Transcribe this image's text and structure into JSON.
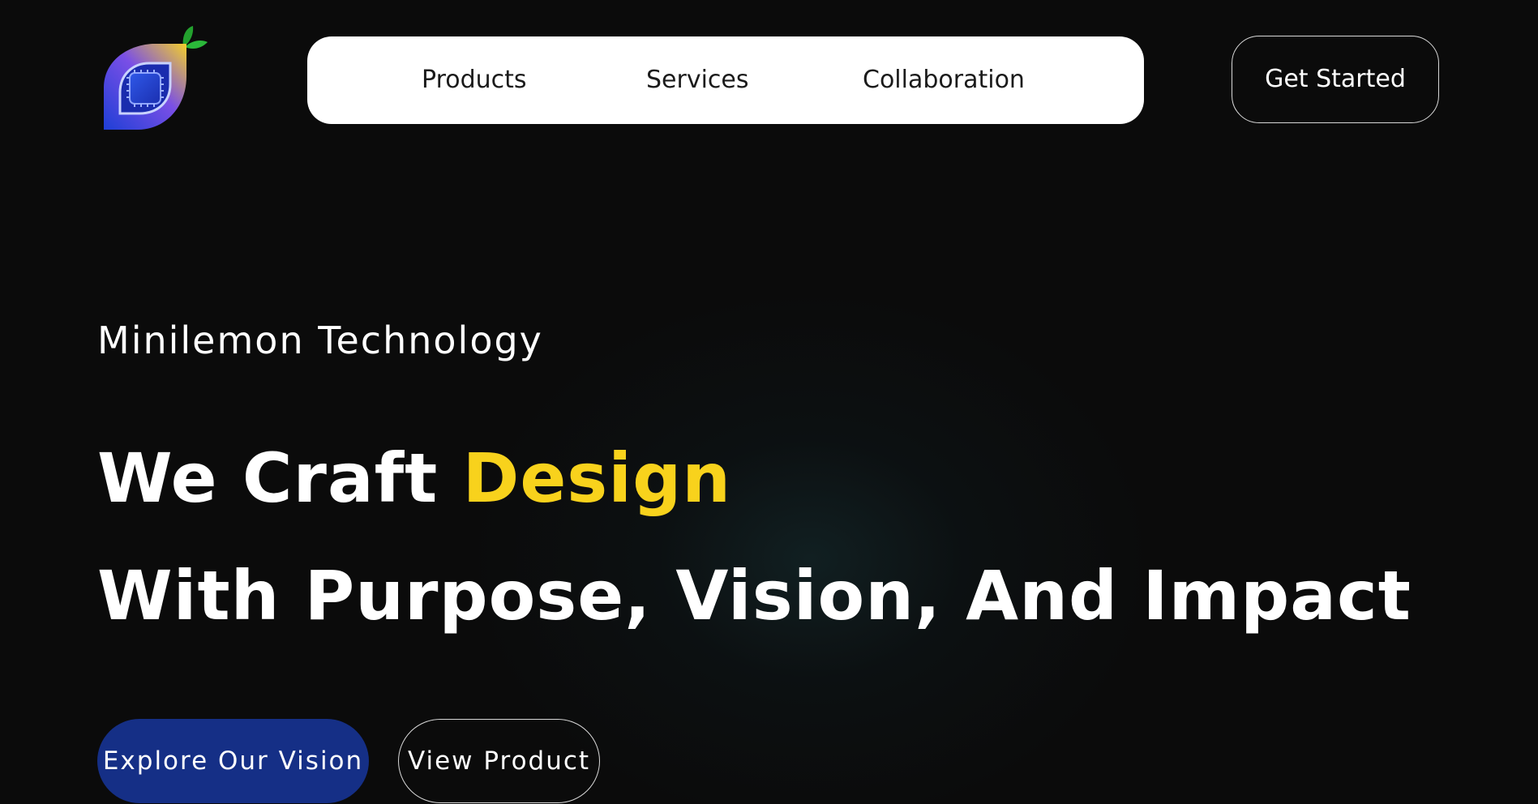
{
  "header": {
    "logo": {
      "icon": "lemon-chip-logo-icon"
    },
    "nav": {
      "items": [
        {
          "label": "Products"
        },
        {
          "label": "Services"
        },
        {
          "label": "Collaboration"
        }
      ]
    },
    "cta_label": "Get Started"
  },
  "hero": {
    "eyebrow": "Minilemon Technology",
    "headline_line1_prefix": "We Craft",
    "headline_line1_accent": "Design",
    "headline_line2": "With Purpose, Vision, And Impact",
    "primary_button_label": "Explore Our Vision",
    "secondary_button_label": "View Product"
  },
  "colors": {
    "background": "#0b0b0b",
    "accent_yellow": "#f8d21c",
    "primary_button": "#152f86",
    "nav_background": "#ffffff"
  }
}
